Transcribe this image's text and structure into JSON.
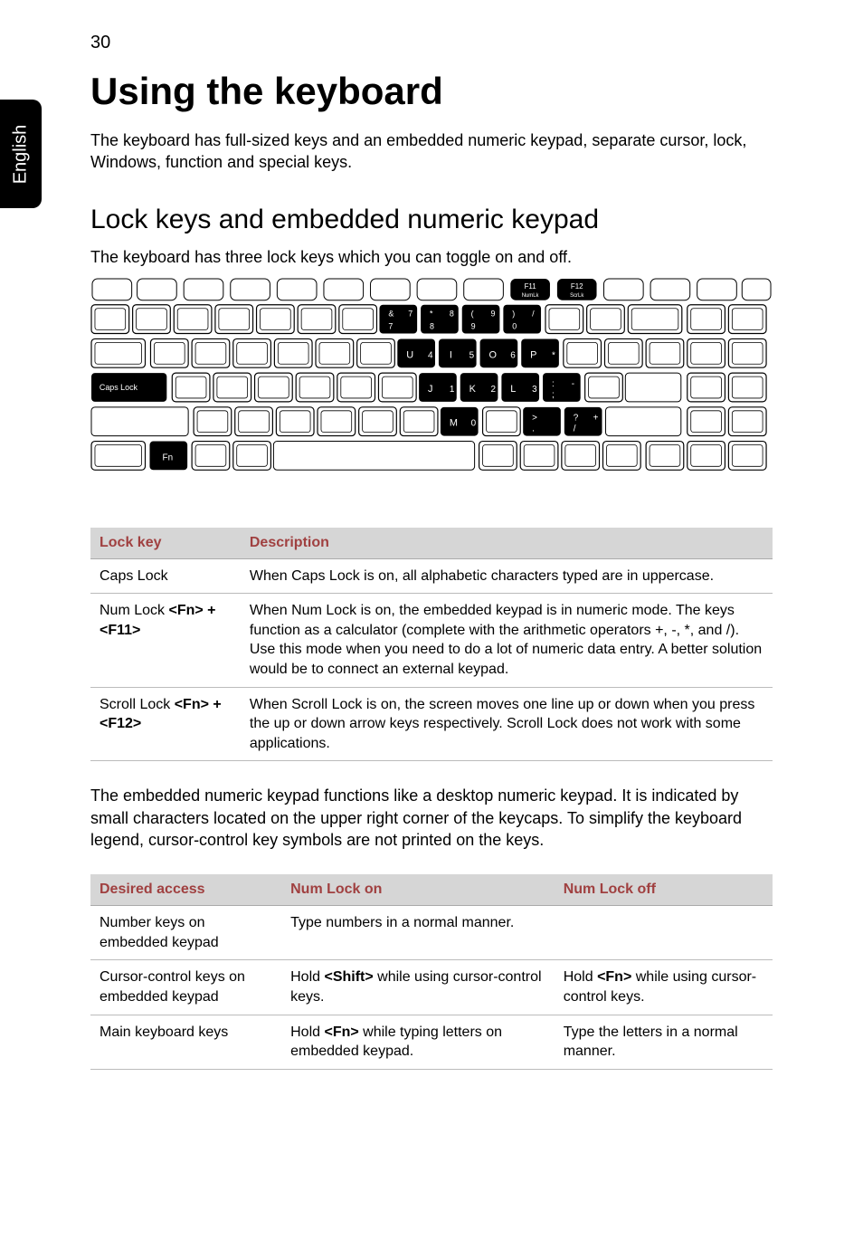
{
  "page_number": "30",
  "side_tab": "English",
  "h1": "Using the keyboard",
  "intro": "The keyboard has full-sized keys and an embedded numeric keypad, separate cursor, lock, Windows, function and special keys.",
  "h2": "Lock keys and embedded numeric keypad",
  "sub": "The keyboard has three lock keys which you can toggle on and off.",
  "keyboard_legend": {
    "f11_top": "F11",
    "f11_sub": "NumLk",
    "f12_top": "F12",
    "f12_sub": "ScrLk",
    "row1": [
      "& 7 7",
      "* 8 8",
      "( 9 9",
      ") / 0"
    ],
    "row2": [
      "U 4",
      "I 5",
      "O 6",
      "P *"
    ],
    "caps": "Caps Lock",
    "row3": [
      "J 1",
      "K 2",
      "L 3",
      ": - ;"
    ],
    "row4": [
      "M 0",
      "> .",
      "? + /"
    ],
    "fn": "Fn"
  },
  "lock_table": {
    "headers": [
      "Lock key",
      "Description"
    ],
    "rows": [
      {
        "key_plain": "Caps Lock",
        "key_bold": "",
        "desc": "When Caps Lock is on, all alphabetic characters typed are in uppercase."
      },
      {
        "key_plain": "Num Lock ",
        "key_bold": "<Fn> + <F11>",
        "desc": "When Num Lock is on, the embedded keypad is in numeric mode. The keys function as a calculator (complete with the arithmetic operators +, -, *, and /). Use this mode when you need to do a lot of numeric data entry. A better solution would be to connect an external keypad."
      },
      {
        "key_plain": "Scroll Lock ",
        "key_bold": "<Fn> + <F12>",
        "desc": "When Scroll Lock is on, the screen moves one line up or down when you press the up or down arrow keys respectively. Scroll Lock does not work with some applications."
      }
    ]
  },
  "para": "The embedded numeric keypad functions like a desktop numeric keypad. It is indicated by small characters located on the upper right corner of the keycaps. To simplify the keyboard legend, cursor-control key symbols are not printed on the keys.",
  "access_table": {
    "headers": [
      "Desired access",
      "Num Lock on",
      "Num Lock off"
    ],
    "rows": [
      {
        "c0": "Number keys on embedded keypad",
        "c1_pre": "Type numbers in a normal manner.",
        "c1_bold": "",
        "c1_post": "",
        "c2_pre": "",
        "c2_bold": "",
        "c2_post": ""
      },
      {
        "c0": "Cursor-control keys on embedded keypad",
        "c1_pre": "Hold ",
        "c1_bold": "<Shift>",
        "c1_post": " while using cursor-control keys.",
        "c2_pre": "Hold ",
        "c2_bold": "<Fn>",
        "c2_post": " while using cursor-control keys."
      },
      {
        "c0": "Main keyboard keys",
        "c1_pre": "Hold ",
        "c1_bold": "<Fn>",
        "c1_post": " while typing letters on embedded keypad.",
        "c2_pre": "Type the letters in a normal manner.",
        "c2_bold": "",
        "c2_post": ""
      }
    ]
  }
}
